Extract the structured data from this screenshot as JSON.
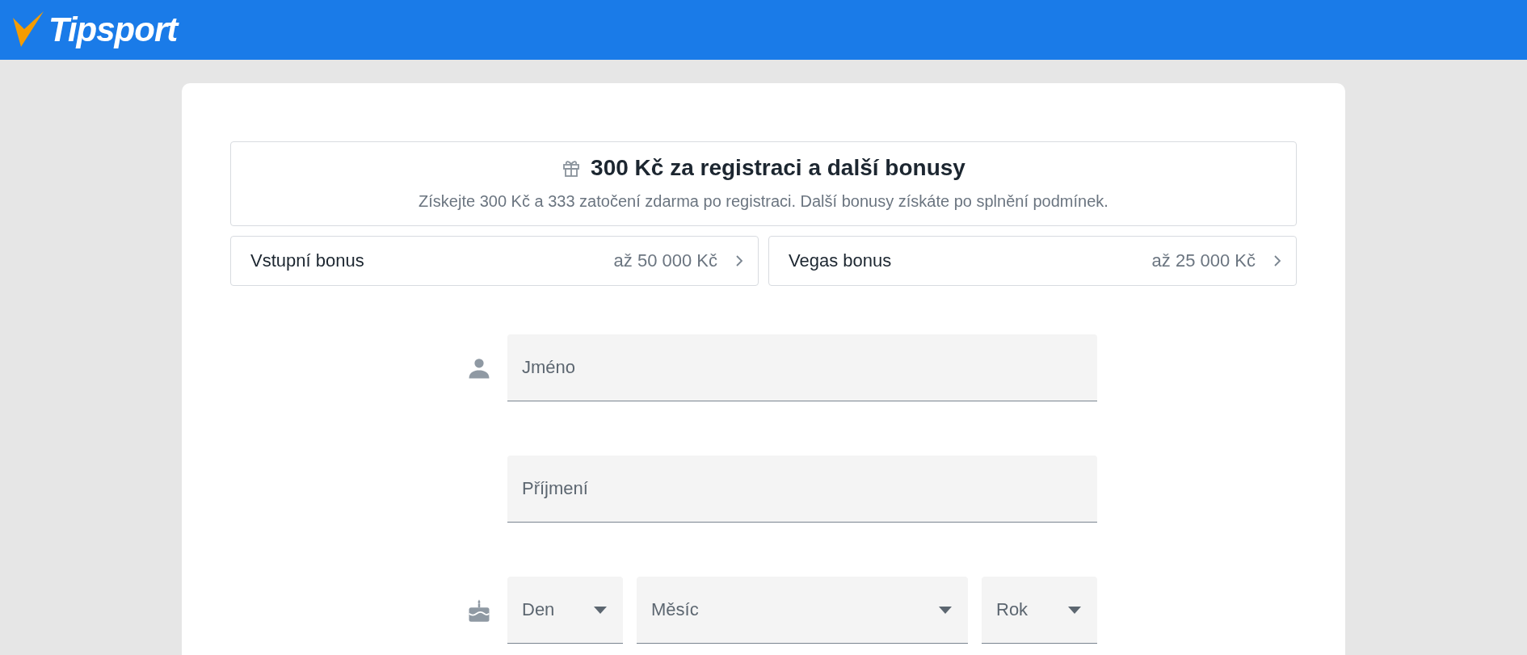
{
  "header": {
    "logo": "Tipsport"
  },
  "promo": {
    "title": "300 Kč za registraci a další bonusy",
    "text": "Získejte 300 Kč a 333 zatočení zdarma po registraci. Další bonusy získáte po splnění podmínek."
  },
  "bonuses": [
    {
      "label": "Vstupní bonus",
      "amount": "až 50 000 Kč"
    },
    {
      "label": "Vegas bonus",
      "amount": "až 25 000 Kč"
    }
  ],
  "form": {
    "first_name": {
      "placeholder": "Jméno"
    },
    "last_name": {
      "placeholder": "Příjmení"
    },
    "birth_date": [
      {
        "placeholder": "Den"
      },
      {
        "placeholder": "Měsíc"
      },
      {
        "placeholder": "Rok"
      }
    ]
  }
}
